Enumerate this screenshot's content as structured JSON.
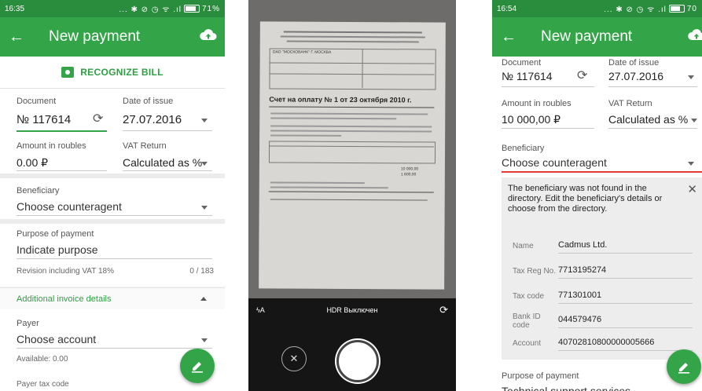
{
  "screen1": {
    "status": {
      "time": "16:35",
      "icons": "... ✱ ⊘ ◷ ᯤ .ıl",
      "battery": "71%"
    },
    "appbar": {
      "title": "New payment"
    },
    "recognize_label": "RECOGNIZE BILL",
    "document": {
      "label": "Document",
      "value": "№ 117614"
    },
    "date": {
      "label": "Date of issue",
      "value": "27.07.2016"
    },
    "amount": {
      "label": "Amount in roubles",
      "value": "0.00 ₽"
    },
    "vat": {
      "label": "VAT Return",
      "value": "Calculated as %"
    },
    "beneficiary": {
      "label": "Beneficiary",
      "value": "Choose counteragent"
    },
    "purpose": {
      "label": "Purpose of payment",
      "placeholder": "Indicate purpose",
      "hint": "Revision including VAT 18%",
      "counter": "0 / 183"
    },
    "additional": "Additional invoice details",
    "payer": {
      "label": "Payer",
      "value": "Choose account",
      "available": "Available: 0.00"
    },
    "payer_tax": "Payer tax code"
  },
  "screen2": {
    "toolbar": {
      "flash": "ϟA",
      "hdr": "HDR Выключен"
    },
    "document": {
      "header": "Счет на оплату № 1 от 23 октября 2010 г.",
      "bank": "ОАО \"МОСКОВАНК\" Г. МОСКВА",
      "totals": "10 000,00",
      "vat_total": "1 600,00"
    }
  },
  "screen3": {
    "status": {
      "time": "16:54",
      "icons": "... ✱ ⊘ ◷ ᯤ .ıl",
      "battery": "70"
    },
    "appbar": {
      "title": "New payment"
    },
    "document": {
      "label": "Document",
      "value": "№ 117614"
    },
    "date": {
      "label": "Date of issue",
      "value": "27.07.2016"
    },
    "amount": {
      "label": "Amount in roubles",
      "value": "10 000,00 ₽"
    },
    "vat": {
      "label": "VAT Return",
      "value": "Calculated as %"
    },
    "beneficiary": {
      "label": "Beneficiary",
      "value": "Choose counteragent"
    },
    "notice": {
      "message": "The beneficiary was not found in the directory. Edit the beneficiary's details or choose from the directory.",
      "name_key": "Name",
      "name_val": "Cadmus Ltd.",
      "taxreg_key": "Tax Reg No.",
      "taxreg_val": "7713195274",
      "taxcode_key": "Tax code",
      "taxcode_val": "771301001",
      "bank_key": "Bank ID code",
      "bank_val": "044579476",
      "account_key": "Account",
      "account_val": "40702810800000005666"
    },
    "purpose": {
      "label": "Purpose of payment",
      "value": "Technical support services"
    }
  },
  "colors": {
    "accent": "#33a548",
    "statusbar": "#2a8d3d",
    "error_line": "#e53935"
  }
}
